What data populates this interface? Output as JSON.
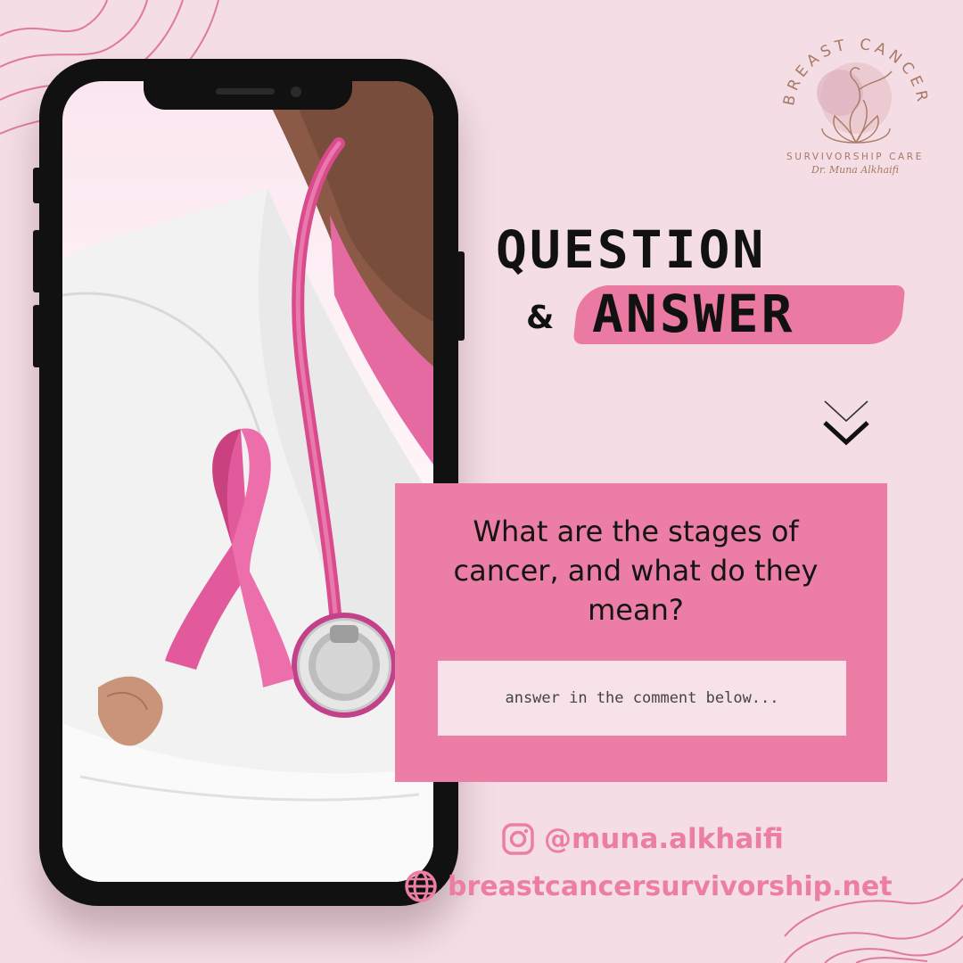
{
  "brand": {
    "logo_arc_text": "BREAST CANCER",
    "logo_subtitle": "SURVIVORSHIP CARE",
    "logo_signature": "Dr. Muna Alkhaifi",
    "accent_color": "#ec7ea6",
    "background_color": "#f4dde4"
  },
  "headline": {
    "line1": "QUESTION",
    "ampersand": "&",
    "line2": "ANSWER"
  },
  "card": {
    "question": "What are the stages of cancer, and what do they mean?",
    "answer_hint": "answer in the comment below..."
  },
  "social": {
    "instagram_icon": "instagram-icon",
    "instagram": "@muna.alkhaifi",
    "web_icon": "globe-icon",
    "website": "breastcancersurvivorship.net"
  },
  "phone_image": {
    "subject": "doctor-with-pink-ribbon-and-stethoscope"
  }
}
